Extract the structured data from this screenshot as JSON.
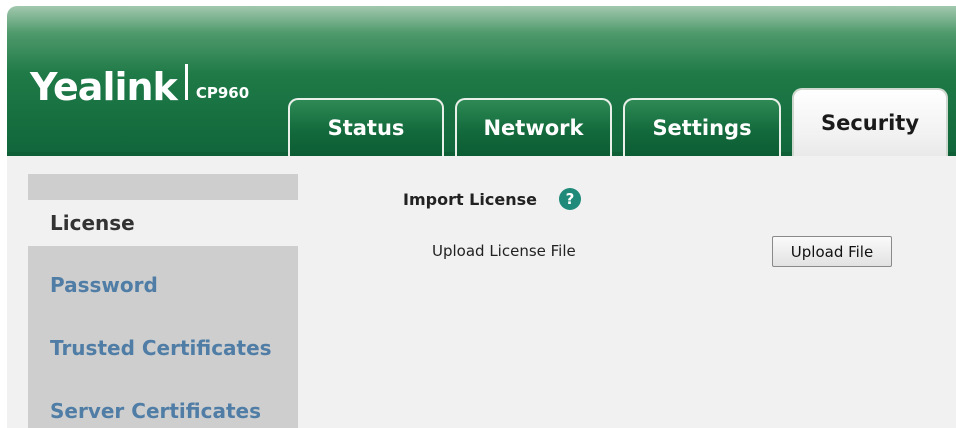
{
  "header": {
    "brand": "Yealink",
    "model": "CP960"
  },
  "tabs": [
    {
      "label": "Status"
    },
    {
      "label": "Network"
    },
    {
      "label": "Settings"
    },
    {
      "label": "Security",
      "active": true
    }
  ],
  "sidebar": {
    "items": [
      {
        "label": "License",
        "active": true
      },
      {
        "label": "Password"
      },
      {
        "label": "Trusted Certificates"
      },
      {
        "label": "Server Certificates"
      }
    ]
  },
  "main": {
    "section_title": "Import License",
    "help_icon_glyph": "?",
    "upload_label": "Upload License File",
    "upload_button": "Upload File"
  },
  "colors": {
    "brand_green": "#10663a",
    "link_blue": "#4f7da6",
    "help_teal": "#1f8a7a"
  }
}
